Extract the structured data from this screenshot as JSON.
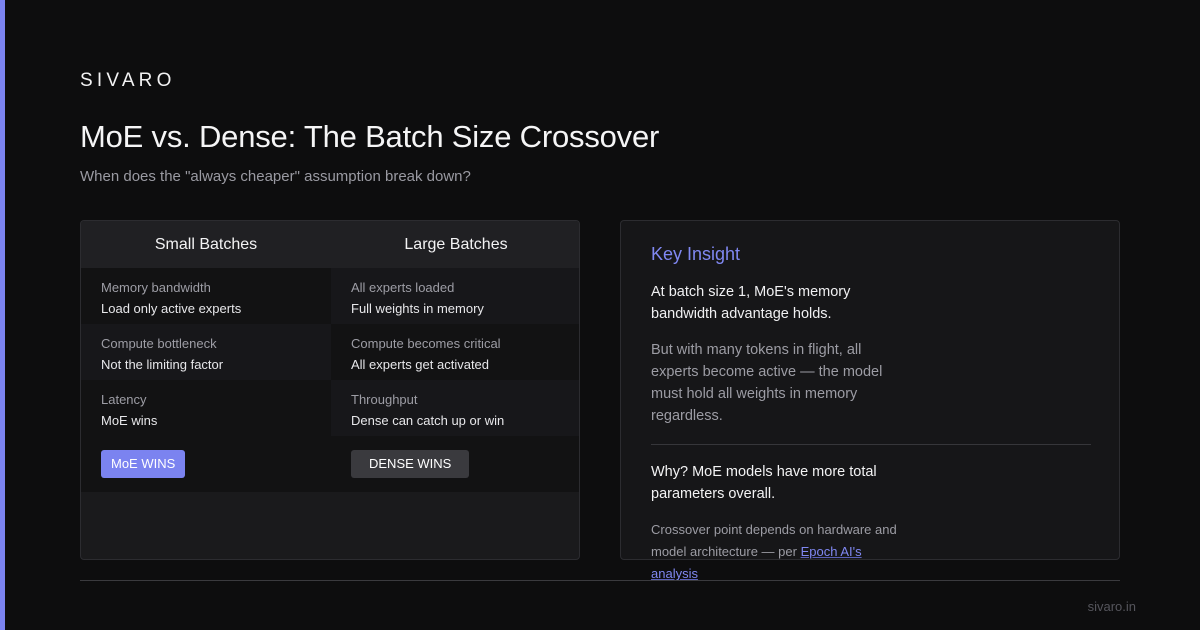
{
  "brand": "SIVARO",
  "title": "MoE vs. Dense: The Batch Size Crossover",
  "subtitle": "When does the \"always cheaper\" assumption break down?",
  "comparison": {
    "small": {
      "header": "Small Batches",
      "rows": [
        {
          "title": "Memory bandwidth",
          "desc": "Load only active experts"
        },
        {
          "title": "Compute bottleneck",
          "desc": "Not the limiting factor"
        },
        {
          "title": "Latency",
          "desc": "MoE wins"
        }
      ],
      "badge": "MoE WINS"
    },
    "large": {
      "header": "Large Batches",
      "rows": [
        {
          "title": "All experts loaded",
          "desc": "Full weights in memory"
        },
        {
          "title": "Compute becomes critical",
          "desc": "All experts get activated"
        },
        {
          "title": "Throughput",
          "desc": "Dense can catch up or win"
        }
      ],
      "badge": "DENSE WINS"
    }
  },
  "insight": {
    "title": "Key Insight",
    "lead": "At batch size 1, MoE's memory bandwidth advantage holds.",
    "body": "But with many tokens in flight, all experts become active — the model must hold all weights in memory regardless.",
    "why": "Why? MoE models have more total parameters overall.",
    "note": "Crossover point depends on hardware and model architecture — per",
    "link": "Epoch AI's analysis"
  },
  "footer": {
    "domain": "sivaro.in"
  },
  "colors": {
    "accent": "#7b83f0",
    "background": "#0d0d0e",
    "card": "#1a1a1c"
  }
}
